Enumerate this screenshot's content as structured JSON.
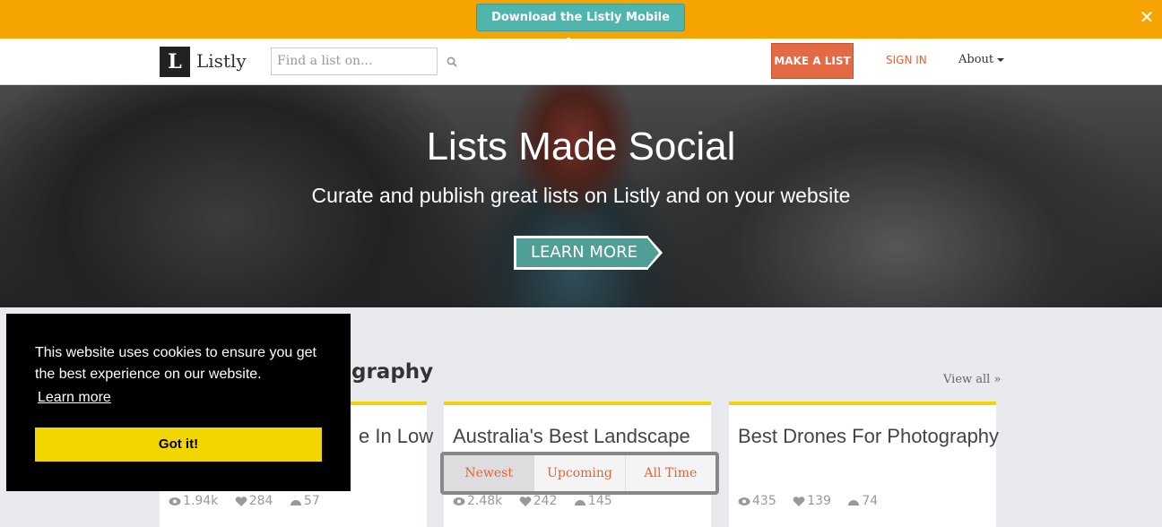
{
  "promo": {
    "button_label": "Download the Listly Mobile Apps",
    "close_icon": "close-icon"
  },
  "nav": {
    "logo_letter": "L",
    "logo_text": "Listly",
    "search_placeholder": "Find a list on...",
    "make_list_label": "MAKE A LIST",
    "sign_in_label": "SIGN IN",
    "about_label": "About"
  },
  "hero": {
    "title": "Lists Made Social",
    "subtitle": "Curate and publish great lists on Listly and on your website",
    "cta_label": "LEARN MORE"
  },
  "section": {
    "title": "graphy",
    "view_all_label": "View all »"
  },
  "cards": [
    {
      "title": "e In Low",
      "views": "1.94k",
      "likes": "284",
      "score": "57"
    },
    {
      "title": "Australia's Best Landscape",
      "views": "2.48k",
      "likes": "242",
      "score": "145"
    },
    {
      "title": "Best Drones For Photography",
      "views": "435",
      "likes": "139",
      "score": "74"
    }
  ],
  "tabs": [
    "Newest",
    "Upcoming",
    "All Time"
  ],
  "cookie": {
    "message": "This website uses cookies to ensure you get the best experience on our website.",
    "learn_more_label": "Learn more",
    "button_label": "Got it!"
  },
  "colors": {
    "promo": "#f5a402",
    "accent": "#e36a44",
    "teal": "#4fb5ad",
    "card_border": "#f2d20a",
    "cookie_button": "#f1d600"
  }
}
